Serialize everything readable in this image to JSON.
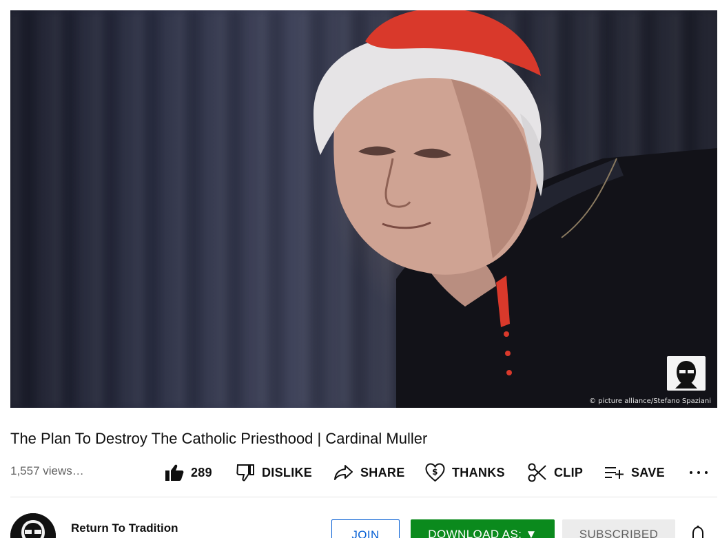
{
  "video": {
    "credit": "© picture alliance/Stefano Spaziani",
    "title": "The Plan To Destroy The Catholic Priesthood | Cardinal Muller"
  },
  "stats": {
    "views": "1,557 views…"
  },
  "actions": {
    "like_count": "289",
    "dislike_label": "DISLIKE",
    "share_label": "SHARE",
    "thanks_label": "THANKS",
    "clip_label": "CLIP",
    "save_label": "SAVE"
  },
  "channel": {
    "name": "Return To Tradition",
    "join_label": "JOIN",
    "download_label": "DOWNLOAD AS: ▼",
    "subscribed_label": "SUBSCRIBED"
  },
  "colors": {
    "download_bg": "#0b8a1d",
    "join_accent": "#065fd4",
    "cap": "#d9392b"
  },
  "icons": [
    "like-icon",
    "dislike-icon",
    "share-icon",
    "thanks-icon",
    "clip-icon",
    "save-icon",
    "more-icon",
    "bell-icon"
  ]
}
